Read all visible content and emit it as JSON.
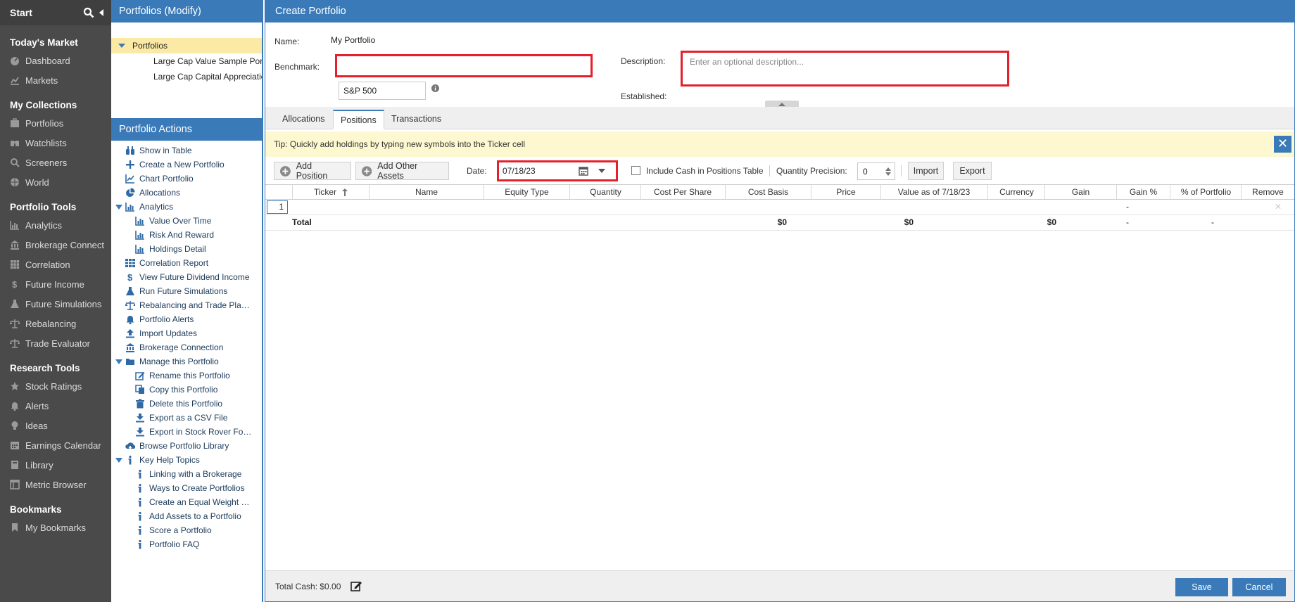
{
  "nav": {
    "start": "Start",
    "sections": [
      {
        "title": "Today's Market",
        "items": [
          "Dashboard",
          "Markets"
        ]
      },
      {
        "title": "My Collections",
        "items": [
          "Portfolios",
          "Watchlists",
          "Screeners",
          "World"
        ]
      },
      {
        "title": "Portfolio Tools",
        "items": [
          "Analytics",
          "Brokerage Connect",
          "Correlation",
          "Future Income",
          "Future Simulations",
          "Rebalancing",
          "Trade Evaluator"
        ]
      },
      {
        "title": "Research Tools",
        "items": [
          "Stock Ratings",
          "Alerts",
          "Ideas",
          "Earnings Calendar",
          "Library",
          "Metric Browser"
        ]
      },
      {
        "title": "Bookmarks",
        "items": [
          "My Bookmarks"
        ]
      }
    ]
  },
  "portfolios_panel": {
    "title": "Portfolios (Modify)",
    "root": "Portfolios",
    "children": [
      "Large Cap Value Sample Portfolio",
      "Large Cap Capital Appreciation"
    ]
  },
  "actions_panel": {
    "title": "Portfolio Actions",
    "items": [
      {
        "label": "Show in Table",
        "icon": "binoculars-icon",
        "level": 0
      },
      {
        "label": "Create a New Portfolio",
        "icon": "plus-icon",
        "level": 0
      },
      {
        "label": "Chart Portfolio",
        "icon": "line-chart-icon",
        "level": 0
      },
      {
        "label": "Allocations",
        "icon": "pie-chart-icon",
        "level": 0
      },
      {
        "label": "Analytics",
        "icon": "bar-chart-icon",
        "level": 0,
        "expanded": true
      },
      {
        "label": "Value Over Time",
        "icon": "bar-chart-icon",
        "level": 1
      },
      {
        "label": "Risk And Reward",
        "icon": "bar-chart-icon",
        "level": 1
      },
      {
        "label": "Holdings Detail",
        "icon": "bar-chart-icon",
        "level": 1
      },
      {
        "label": "Correlation Report",
        "icon": "grid-icon",
        "level": 0
      },
      {
        "label": "View Future Dividend Income",
        "icon": "dollar-icon",
        "level": 0
      },
      {
        "label": "Run Future Simulations",
        "icon": "flask-icon",
        "level": 0
      },
      {
        "label": "Rebalancing and Trade Pla…",
        "icon": "scale-icon",
        "level": 0
      },
      {
        "label": "Portfolio Alerts",
        "icon": "bell-icon",
        "level": 0
      },
      {
        "label": "Import Updates",
        "icon": "upload-icon",
        "level": 0
      },
      {
        "label": "Brokerage Connection",
        "icon": "bank-icon",
        "level": 0
      },
      {
        "label": "Manage this Portfolio",
        "icon": "folder-icon",
        "level": 0,
        "expanded": true
      },
      {
        "label": "Rename this Portfolio",
        "icon": "edit-icon",
        "level": 1
      },
      {
        "label": "Copy this Portfolio",
        "icon": "copy-icon",
        "level": 1
      },
      {
        "label": "Delete this Portfolio",
        "icon": "trash-icon",
        "level": 1
      },
      {
        "label": "Export as a CSV File",
        "icon": "download-icon",
        "level": 1
      },
      {
        "label": "Export in Stock Rover Fo…",
        "icon": "download-icon",
        "level": 1
      },
      {
        "label": "Browse Portfolio Library",
        "icon": "cloud-download-icon",
        "level": 0
      },
      {
        "label": "Key Help Topics",
        "icon": "info-icon",
        "level": 0,
        "expanded": true
      },
      {
        "label": "Linking with a Brokerage",
        "icon": "info-icon",
        "level": 1
      },
      {
        "label": "Ways to Create Portfolios",
        "icon": "info-icon",
        "level": 1
      },
      {
        "label": "Create an Equal Weight …",
        "icon": "info-icon",
        "level": 1
      },
      {
        "label": "Add Assets to a Portfolio",
        "icon": "info-icon",
        "level": 1
      },
      {
        "label": "Score a Portfolio",
        "icon": "info-icon",
        "level": 1
      },
      {
        "label": "Portfolio FAQ",
        "icon": "info-icon",
        "level": 1
      }
    ]
  },
  "create": {
    "title": "Create Portfolio",
    "name_label": "Name:",
    "name_value": "My Portfolio",
    "benchmark_label": "Benchmark:",
    "benchmark_value": "S&P 500",
    "description_label": "Description:",
    "description_placeholder": "Enter an optional description...",
    "established_label": "Established:"
  },
  "tabs": [
    "Allocations",
    "Positions",
    "Transactions"
  ],
  "active_tab": "Positions",
  "tip": "Tip: Quickly add holdings by typing new symbols into the Ticker cell",
  "toolbar": {
    "add_position": "Add Position",
    "add_other": "Add Other Assets",
    "date_label": "Date:",
    "date_value": "07/18/23",
    "include_cash": "Include Cash in Positions Table",
    "qty_precision_label": "Quantity Precision:",
    "qty_precision_value": "0",
    "import": "Import",
    "export": "Export"
  },
  "table": {
    "columns": [
      "Ticker",
      "Name",
      "Equity Type",
      "Quantity",
      "Cost Per Share",
      "Cost Basis",
      "Price",
      "Value as of 7/18/23",
      "Currency",
      "Gain",
      "Gain %",
      "% of Portfolio",
      "Remove"
    ],
    "row_number": "1",
    "row_gain_pct": "-",
    "total_label": "Total",
    "total_cost_basis": "$0",
    "total_value": "$0",
    "total_gain": "$0",
    "total_gain_pct": "-",
    "total_pct_portfolio": "-"
  },
  "footer": {
    "total_cash": "Total Cash: $0.00",
    "save": "Save",
    "cancel": "Cancel"
  },
  "colors": {
    "accent": "#3a7ab8",
    "highlight": "#e3202b",
    "nav_bg": "#4a4a4a",
    "tip_bg": "#fdf8cf"
  }
}
